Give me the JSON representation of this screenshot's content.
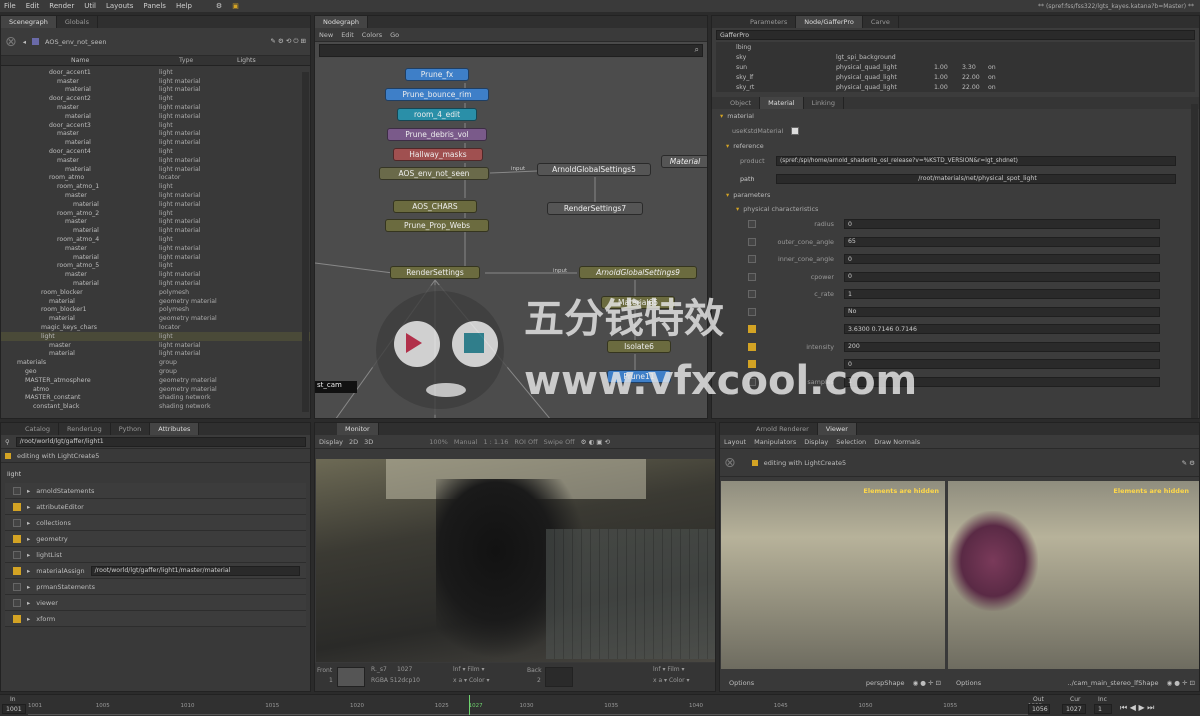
{
  "menubar": {
    "items": [
      "File",
      "Edit",
      "Render",
      "Util",
      "Layouts",
      "Panels",
      "Help"
    ],
    "project_path": "** (spref:fss/fss322/lgts_kayes.katana?b=Master) **"
  },
  "scenegraph": {
    "tabs": [
      "Scenegraph",
      "Globals"
    ],
    "root_label": "AOS_env_not_seen",
    "columns": [
      "Name",
      "Type",
      "Lights"
    ],
    "rows": [
      {
        "name": "door_accent1",
        "type": "light",
        "d": 5
      },
      {
        "name": "master",
        "type": "light material",
        "d": 6
      },
      {
        "name": "material",
        "type": "light material",
        "d": 7
      },
      {
        "name": "door_accent2",
        "type": "light",
        "d": 5
      },
      {
        "name": "master",
        "type": "light material",
        "d": 6
      },
      {
        "name": "material",
        "type": "light material",
        "d": 7
      },
      {
        "name": "door_accent3",
        "type": "light",
        "d": 5
      },
      {
        "name": "master",
        "type": "light material",
        "d": 6
      },
      {
        "name": "material",
        "type": "light material",
        "d": 7
      },
      {
        "name": "door_accent4",
        "type": "light",
        "d": 5
      },
      {
        "name": "master",
        "type": "light material",
        "d": 6
      },
      {
        "name": "material",
        "type": "light material",
        "d": 7
      },
      {
        "name": "room_atmo",
        "type": "locator",
        "d": 5
      },
      {
        "name": "room_atmo_1",
        "type": "light",
        "d": 6
      },
      {
        "name": "master",
        "type": "light material",
        "d": 7
      },
      {
        "name": "material",
        "type": "light material",
        "d": 8
      },
      {
        "name": "room_atmo_2",
        "type": "light",
        "d": 6
      },
      {
        "name": "master",
        "type": "light material",
        "d": 7
      },
      {
        "name": "material",
        "type": "light material",
        "d": 8
      },
      {
        "name": "room_atmo_4",
        "type": "light",
        "d": 6
      },
      {
        "name": "master",
        "type": "light material",
        "d": 7
      },
      {
        "name": "material",
        "type": "light material",
        "d": 8
      },
      {
        "name": "room_atmo_5",
        "type": "light",
        "d": 6
      },
      {
        "name": "master",
        "type": "light material",
        "d": 7
      },
      {
        "name": "material",
        "type": "light material",
        "d": 8
      },
      {
        "name": "room_blocker",
        "type": "polymesh",
        "d": 4
      },
      {
        "name": "material",
        "type": "geometry material",
        "d": 5
      },
      {
        "name": "room_blocker1",
        "type": "polymesh",
        "d": 4
      },
      {
        "name": "material",
        "type": "geometry material",
        "d": 5
      },
      {
        "name": "magic_keys_chars",
        "type": "locator",
        "d": 4
      },
      {
        "name": "light",
        "type": "light",
        "d": 4
      },
      {
        "name": "master",
        "type": "light material",
        "d": 5
      },
      {
        "name": "material",
        "type": "light material",
        "d": 5
      },
      {
        "name": "materials",
        "type": "group",
        "d": 1
      },
      {
        "name": "geo",
        "type": "group",
        "d": 2
      },
      {
        "name": "MASTER_atmosphere",
        "type": "geometry material",
        "d": 2
      },
      {
        "name": "atmo",
        "type": "geometry material",
        "d": 3
      },
      {
        "name": "MASTER_constant",
        "type": "shading network",
        "d": 2
      },
      {
        "name": "constant_black",
        "type": "shading network",
        "d": 3
      }
    ]
  },
  "nodegraph": {
    "tab": "Nodegraph",
    "menu": [
      "New",
      "Edit",
      "Colors",
      "Go"
    ],
    "nodes": [
      {
        "label": "Prune_fx",
        "color": "#3e7fc8"
      },
      {
        "label": "Prune_bounce_rim",
        "color": "#3e7fc8"
      },
      {
        "label": "room_4_edit",
        "color": "#2a8fa8"
      },
      {
        "label": "Prune_debris_vol",
        "color": "#7a5a8a"
      },
      {
        "label": "Hallway_masks",
        "color": "#a05050"
      },
      {
        "label": "AOS_env_not_seen",
        "color": "#6a6a4a"
      },
      {
        "label": "ArnoldGlobalSettings5",
        "color": "#555555"
      },
      {
        "label": "Material",
        "color": "#555555"
      },
      {
        "label": "AOS_CHARS",
        "color": "#6b6b3f"
      },
      {
        "label": "RenderSettings7",
        "color": "#555555"
      },
      {
        "label": "Prune_Prop_Webs",
        "color": "#6b6b3f"
      },
      {
        "label": "RenderSettings",
        "color": "#6b6b3f"
      },
      {
        "label": "ArnoldGlobalSettings9",
        "color": "#6b6b3f"
      },
      {
        "label": "Material65",
        "color": "#6b6b3f"
      },
      {
        "label": "Isolate6",
        "color": "#6b6b3f"
      },
      {
        "label": "Prune11",
        "color": "#3e7fc8"
      }
    ],
    "port_input": "input",
    "camera_label": "st_cam"
  },
  "params": {
    "tabs": [
      "Parameters",
      "Node/GafferPro",
      "Carve"
    ],
    "gaffer_label": "GafferPro",
    "lights": [
      {
        "name": "lbing",
        "mat": "",
        "a": "",
        "b": "",
        "c": ""
      },
      {
        "name": "sky",
        "mat": "lgt_spi_background",
        "a": "",
        "b": "",
        "c": ""
      },
      {
        "name": "sun",
        "mat": "physical_quad_light",
        "a": "1.00",
        "b": "3.30",
        "c": "on"
      },
      {
        "name": "sky_lf",
        "mat": "physical_quad_light",
        "a": "1.00",
        "b": "22.00",
        "c": "on"
      },
      {
        "name": "sky_rt",
        "mat": "physical_quad_light",
        "a": "1.00",
        "b": "22.00",
        "c": "on"
      }
    ],
    "subtabs": [
      "Object",
      "Material",
      "Linking"
    ],
    "section_material": "material",
    "use_label": "useKstdMaterial",
    "section_reference": "reference",
    "product_label": "product",
    "product_value": "(spref:/spi/home/arnold_shaderlib_osl_release?v=%KSTD_VERSION&r=lgt_shdnet)",
    "path_label": "path",
    "path_value": "/root/materials/net/physical_spot_light",
    "section_parameters": "parameters",
    "section_physical": "physical characteristics",
    "rows": [
      {
        "label": "radius",
        "value": "0"
      },
      {
        "label": "outer_cone_angle",
        "value": "65"
      },
      {
        "label": "inner_cone_angle",
        "value": "0"
      },
      {
        "label": "cpower",
        "value": "0"
      },
      {
        "label": "c_rate",
        "value": "1"
      },
      {
        "label": "",
        "value": "No"
      },
      {
        "label": "",
        "value": "3.6300   0.7146   0.7146"
      },
      {
        "label": "intensity",
        "value": "200"
      },
      {
        "label": "",
        "value": "0"
      },
      {
        "label": "samples",
        "value": "1"
      }
    ]
  },
  "attributes": {
    "tabs": [
      "Catalog",
      "RenderLog",
      "Python",
      "Attributes"
    ],
    "path": "/root/world/lgt/gaffer/light1",
    "editing": "editing with LightCreate5",
    "section": "light",
    "groups": [
      "arnoldStatements",
      "attributeEditor",
      "collections",
      "geometry",
      "lightList",
      "materialAssign",
      "prmanStatements",
      "viewer",
      "xform"
    ],
    "material_assign_value": "/root/world/lgt/gaffer/light1/master/material"
  },
  "monitor": {
    "tab": "Monitor",
    "toolbar": [
      "Display",
      "2D",
      "3D"
    ],
    "zoom": "100%",
    "mode": "Manual",
    "ratio": "1 : 1.16",
    "roi": "ROI Off",
    "swipe": "Swipe Off",
    "front_label": "Front",
    "back_label": "Back",
    "front_num": "1",
    "back_num": "2",
    "frame_name": "R._s7",
    "frame_num": "1027",
    "channels": "RGBA 512dcp10",
    "filter": "lnf ▾ Film ▾",
    "color": "x a ▾ Color ▾"
  },
  "viewer": {
    "tabs": [
      "Arnold Renderer",
      "Viewer"
    ],
    "menu": [
      "Layout",
      "Manipulators",
      "Display",
      "Selection",
      "Draw Normals"
    ],
    "editing": "editing with LightCreate5",
    "hidden_note": "Elements are hidden",
    "left_shape": "perspShape",
    "right_shape": "../cam_main_stereo_lfShape",
    "options": "Options"
  },
  "timeline": {
    "in_label": "In",
    "in_value": "1001",
    "ticks": [
      "1001",
      "1005",
      "1010",
      "1015",
      "1020",
      "1025",
      "1027",
      "1030",
      "1035",
      "1040",
      "1045",
      "1050",
      "1055",
      "1060"
    ],
    "out_label": "Out",
    "out_value": "1056",
    "cur_label": "Cur",
    "cur_value": "1027",
    "inc_label": "Inc",
    "inc_value": "1"
  },
  "watermark": "五分钱特效 www.vfxcool.com",
  "colors": {
    "accent": "#d3a324",
    "select": "#4a4a38",
    "blue_node": "#3e7fc8"
  }
}
